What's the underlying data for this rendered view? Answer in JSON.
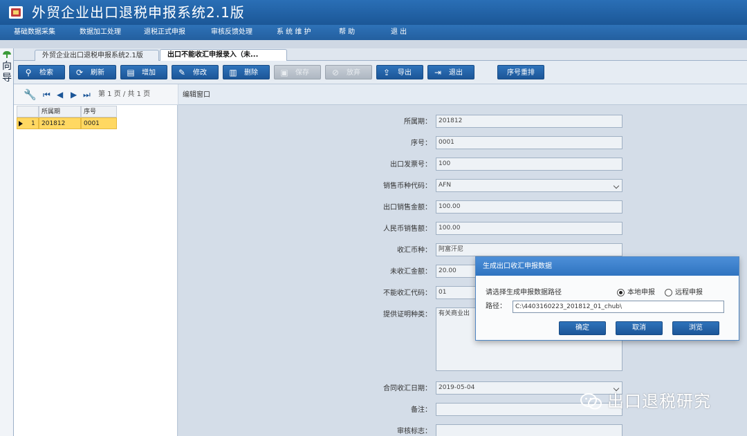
{
  "window": {
    "title": "外贸企业出口退税申报系统2.1版"
  },
  "menu": [
    "基础数据采集",
    "数据加工处理",
    "退税正式申报",
    "审核反馈处理",
    "系 统 维 护",
    "帮 助",
    "退 出"
  ],
  "nav": {
    "label": "向导"
  },
  "tabs": [
    {
      "label": "外贸企业出口退税申报系统2.1版"
    },
    {
      "label": "出口不能收汇申报录入（未..."
    }
  ],
  "toolbar": [
    {
      "label": "检索",
      "icon": "search-icon",
      "enabled": true
    },
    {
      "label": "刷新",
      "icon": "refresh-icon",
      "enabled": true
    },
    {
      "label": "增加",
      "icon": "add-document-icon",
      "enabled": true
    },
    {
      "label": "修改",
      "icon": "edit-icon",
      "enabled": true
    },
    {
      "label": "删除",
      "icon": "trash-icon",
      "enabled": true
    },
    {
      "label": "保存",
      "icon": "save-icon",
      "enabled": false
    },
    {
      "label": "放弃",
      "icon": "cancel-icon",
      "enabled": false
    },
    {
      "label": "导出",
      "icon": "export-icon",
      "enabled": true
    },
    {
      "label": "退出",
      "icon": "exit-icon",
      "enabled": true
    },
    {
      "label": "序号重排",
      "icon": "",
      "enabled": true
    }
  ],
  "pager": {
    "text": "第 1 页 / 共 1 页"
  },
  "grid": {
    "columns": [
      "所属期",
      "序号"
    ],
    "rows": [
      {
        "index": "1",
        "period": "201812",
        "seq": "0001"
      }
    ]
  },
  "edit": {
    "title": "编辑窗口",
    "fields": [
      {
        "label": "所属期：",
        "value": "201812"
      },
      {
        "label": "序号：",
        "value": "0001"
      },
      {
        "label": "出口发票号：",
        "value": "100"
      },
      {
        "label": "销售币种代码：",
        "value": "AFN",
        "dropdown": true
      },
      {
        "label": "出口销售金额：",
        "value": "100.00"
      },
      {
        "label": "人民币销售额：",
        "value": "100.00"
      },
      {
        "label": "收汇币种：",
        "value": "阿富汗尼"
      },
      {
        "label": "未收汇金额：",
        "value": "20.00"
      },
      {
        "label": "不能收汇代码：",
        "value": "01"
      },
      {
        "label": "提供证明种类：",
        "value": "有关商业出"
      },
      {
        "label": "合同收汇日期：",
        "value": "2019-05-04",
        "dropdown": true
      },
      {
        "label": "备注：",
        "value": ""
      },
      {
        "label": "审核标志：",
        "value": ""
      }
    ]
  },
  "dialog": {
    "title": "生成出口收汇申报数据",
    "prompt": "请选择生成申报数据路径",
    "options": [
      {
        "label": "本地申报",
        "checked": true
      },
      {
        "label": "远程申报",
        "checked": false
      }
    ],
    "path_label": "路径：",
    "path_value": "C:\\4403160223_201812_01_chub\\",
    "buttons": {
      "ok": "确定",
      "cancel": "取消",
      "browse": "浏览"
    }
  },
  "watermark": {
    "text": "出口退税研究"
  }
}
